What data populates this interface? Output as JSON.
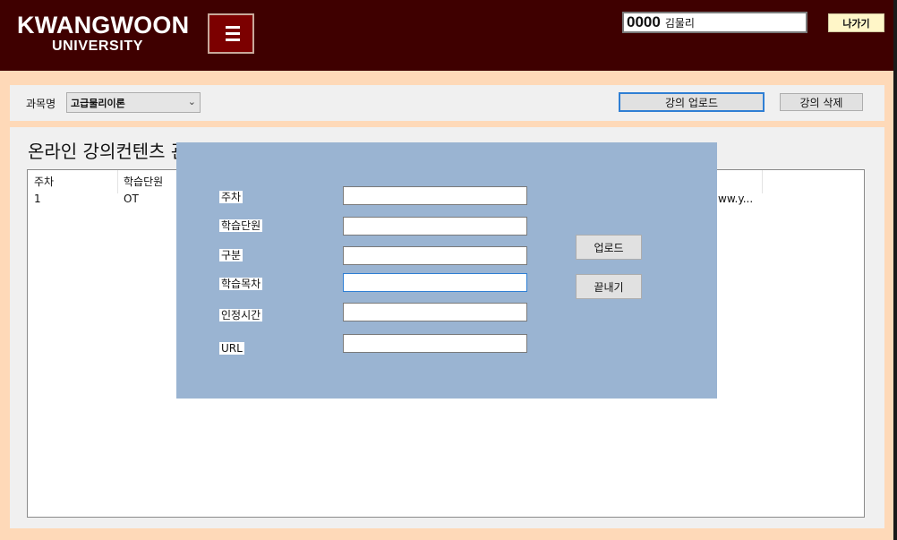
{
  "header": {
    "logo_line1": "KWANGWOON",
    "logo_line2": "UNIVERSITY",
    "user_id": "0000",
    "user_name": "김물리",
    "exit_label": "나가기"
  },
  "toolbar": {
    "subject_label": "과목명",
    "subject_selected": "고급물리이론",
    "upload_label": "강의 업로드",
    "delete_label": "강의 삭제"
  },
  "main": {
    "title": "온라인 강의컨텐츠 관리",
    "columns": [
      "주차",
      "학습단원"
    ],
    "rows": [
      {
        "week": "1",
        "unit": "OT",
        "url_partial": "ww.y..."
      }
    ]
  },
  "dialog": {
    "fields": [
      {
        "label": "주차",
        "value": ""
      },
      {
        "label": "학습단원",
        "value": ""
      },
      {
        "label": "구분",
        "value": ""
      },
      {
        "label": "학습목차",
        "value": ""
      },
      {
        "label": "인정시간",
        "value": ""
      },
      {
        "label": "URL",
        "value": ""
      }
    ],
    "upload_button": "업로드",
    "close_button": "끝내기"
  },
  "colors": {
    "header_bg": "#3f0000",
    "menu_button_bg": "#7c0000",
    "window_bg": "#fed9b8",
    "dialog_bg": "#9ab4d2",
    "focus_accent": "#2f7fd4"
  }
}
